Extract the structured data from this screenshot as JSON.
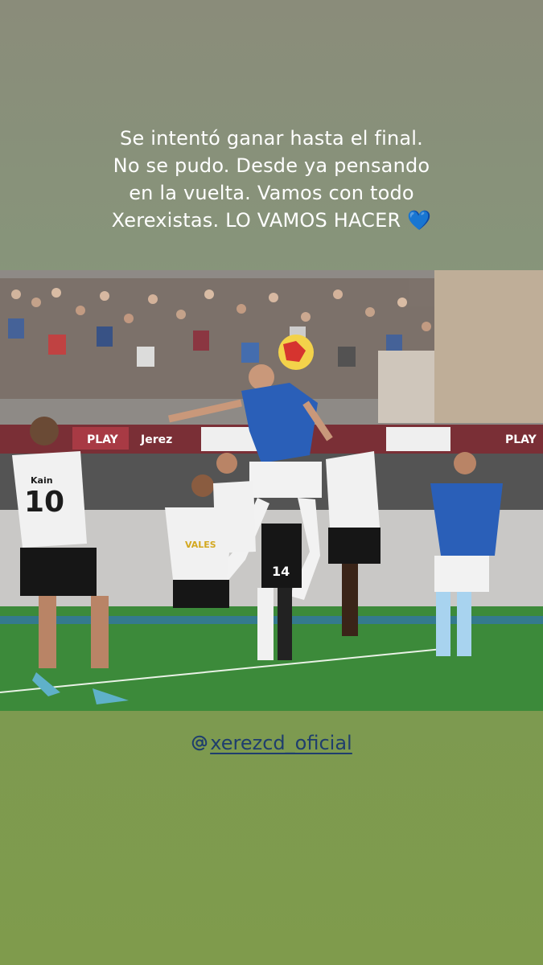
{
  "story": {
    "caption_lines": [
      "Se intentó ganar hasta el final.",
      "No se pudo. Desde ya pensando",
      "en la vuelta. Vamos con todo",
      "Xerexistas. LO VAMOS HACER"
    ],
    "heart_emoji": "💙"
  },
  "photo": {
    "banner_texts": [
      "PLAY",
      "Jerez",
      "PLAY"
    ],
    "jersey_numbers": [
      "10",
      "14"
    ],
    "player_name": "Kain",
    "sponsor": "VALES"
  },
  "mention": {
    "handle": "@xerezcd_oficial"
  },
  "colors": {
    "top_bg": "#8a8c7a",
    "bottom_bg": "#7f9b4c",
    "mention_text": "#1f3e6d",
    "heart": "#2f8fe8",
    "blue_kit": "#2a5fb8",
    "white_kit": "#f1f1f1",
    "pitch": "#3c8a3a"
  }
}
